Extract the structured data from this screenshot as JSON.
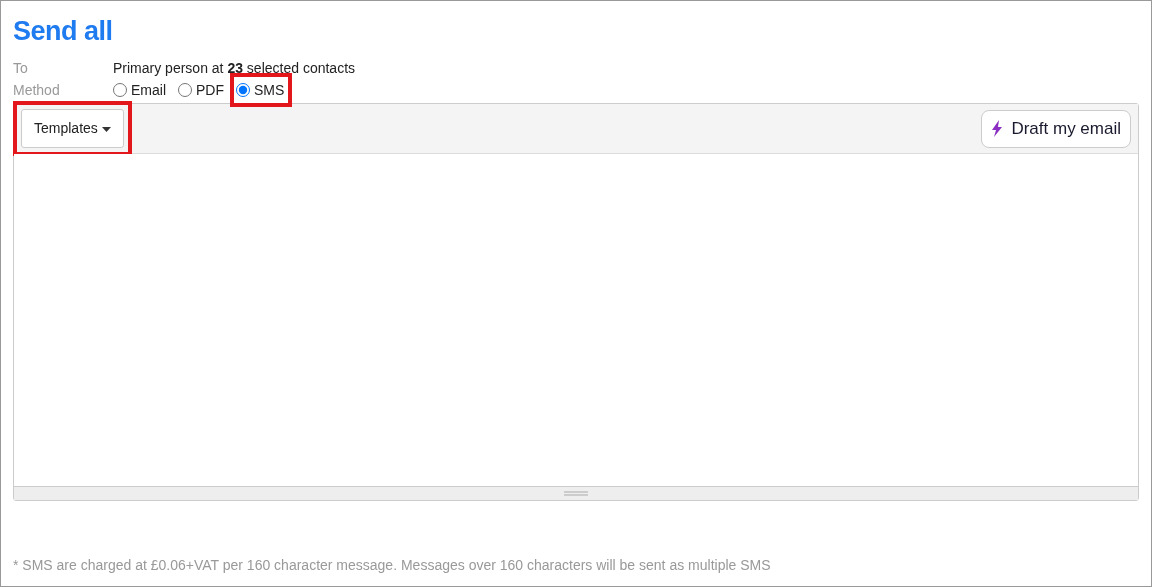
{
  "title": "Send all",
  "fields": [
    {
      "label": "To",
      "value": "Primary person at **23** selected contacts"
    },
    {
      "label": "Method",
      "options": [
        {
          "label": "Email",
          "selected": false,
          "highlighted": false
        },
        {
          "label": "PDF",
          "selected": false,
          "highlighted": false
        },
        {
          "label": "SMS",
          "selected": true,
          "highlighted": true
        }
      ]
    }
  ],
  "editor": {
    "templates_button": {
      "label": "Templates",
      "highlighted": true
    },
    "draft_button": {
      "label": "Draft my email"
    }
  },
  "footnote": "* SMS are charged at £0.06+VAT per 160 character message. Messages over 160 characters will be sent as multiple SMS"
}
